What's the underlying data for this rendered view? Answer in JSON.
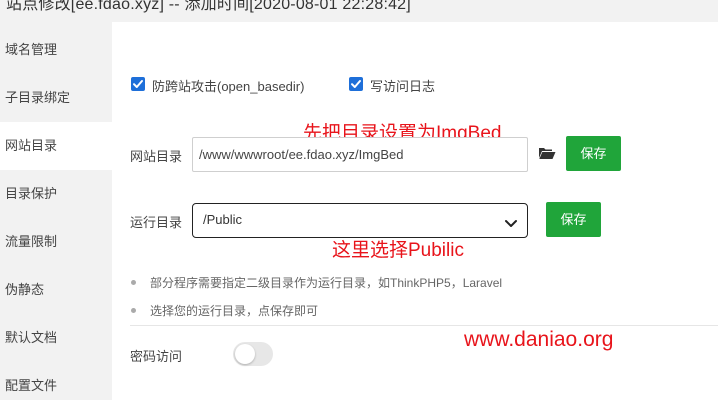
{
  "window": {
    "title": "站点修改[ee.fdao.xyz] -- 添加时间[2020-08-01 22:28:42]"
  },
  "sidebar": {
    "items": [
      {
        "label": "域名管理"
      },
      {
        "label": "子目录绑定"
      },
      {
        "label": "网站目录",
        "active": true
      },
      {
        "label": "目录保护"
      },
      {
        "label": "流量限制"
      },
      {
        "label": "伪静态"
      },
      {
        "label": "默认文档"
      },
      {
        "label": "配置文件"
      }
    ]
  },
  "options": {
    "open_basedir": {
      "label": "防跨站攻击(open_basedir)",
      "checked": true
    },
    "access_log": {
      "label": "写访问日志",
      "checked": true
    }
  },
  "site_dir": {
    "label": "网站目录",
    "value": "/www/wwwroot/ee.fdao.xyz/ImgBed",
    "folder_icon": "folder-open-icon",
    "save_label": "保存"
  },
  "run_dir": {
    "label": "运行目录",
    "selected": "/Public",
    "save_label": "保存"
  },
  "annotations": {
    "set_dir": "先把目录设置为ImgBed",
    "select_public": "这里选择Pubilic",
    "site": "www.daniao.org",
    "color": "#e8141b"
  },
  "tips": [
    "部分程序需要指定二级目录作为运行目录，如ThinkPHP5，Laravel",
    "选择您的运行目录，点保存即可"
  ],
  "password_access": {
    "label": "密码访问",
    "enabled": false
  },
  "colors": {
    "accent_green": "#20a53a",
    "checkbox_blue": "#1e6fd9",
    "sidebar_bg": "#f2f2f2"
  }
}
